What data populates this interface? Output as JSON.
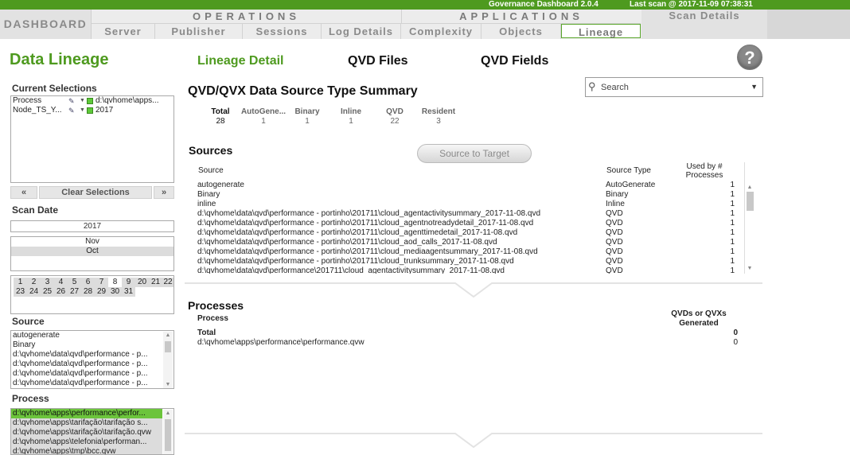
{
  "topbar": {
    "title": "Governance Dashboard 2.0.4",
    "scan": "Last scan @ 2017-11-09 07:38:31"
  },
  "nav": {
    "dashboard": "DASHBOARD",
    "operations": "OPERATIONS",
    "applications": "APPLICATIONS",
    "scan_details": "Scan Details",
    "tabs": [
      "Server",
      "Publisher",
      "Sessions",
      "Log Details",
      "Complexity",
      "Objects",
      "Lineage"
    ]
  },
  "header": {
    "title": "Data Lineage",
    "subnav": [
      "Lineage Detail",
      "QVD Files",
      "QVD Fields"
    ],
    "help": "?"
  },
  "left": {
    "current_selections_label": "Current Selections",
    "selections": [
      {
        "field": "Process",
        "value": "d:\\qvhome\\apps..."
      },
      {
        "field": "Node_TS_Y...",
        "value": "2017"
      }
    ],
    "prev": "«",
    "clear": "Clear Selections",
    "next": "»",
    "scan_date_label": "Scan Date",
    "year": "2017",
    "months": [
      "Nov",
      "Oct"
    ],
    "days": [
      "1",
      "2",
      "3",
      "4",
      "5",
      "6",
      "7",
      "8",
      "9",
      "20",
      "21",
      "22",
      "23",
      "24",
      "25",
      "26",
      "27",
      "28",
      "29",
      "30",
      "31"
    ],
    "source_label": "Source",
    "sources": [
      "autogenerate",
      "Binary",
      "d:\\qvhome\\data\\qvd\\performance - p...",
      "d:\\qvhome\\data\\qvd\\performance - p...",
      "d:\\qvhome\\data\\qvd\\performance - p...",
      "d:\\qvhome\\data\\qvd\\performance - p..."
    ],
    "process_label": "Process",
    "processes": [
      "d:\\qvhome\\apps\\performance\\perfor...",
      "d:\\qvhome\\apps\\tarifação\\tarifação s...",
      "d:\\qvhome\\apps\\tarifação\\tarifação.qvw",
      "d:\\qvhome\\apps\\telefonia\\performan...",
      "d:\\qvhome\\apps\\tmp\\bcc.qvw"
    ]
  },
  "main": {
    "title": "QVD/QVX Data Source Type Summary",
    "search_placeholder": "Search",
    "kpis": [
      {
        "label": "Total",
        "value": "28"
      },
      {
        "label": "AutoGene...",
        "value": "1"
      },
      {
        "label": "Binary",
        "value": "1"
      },
      {
        "label": "Inline",
        "value": "1"
      },
      {
        "label": "QVD",
        "value": "22"
      },
      {
        "label": "Resident",
        "value": "3"
      }
    ],
    "sources_title": "Sources",
    "source_to_target": "Source to Target",
    "sources_headers": {
      "source": "Source",
      "type": "Source Type",
      "used": "Used by # Processes"
    },
    "sources_rows": [
      {
        "source": "autogenerate",
        "type": "AutoGenerate",
        "used": "1"
      },
      {
        "source": "Binary",
        "type": "Binary",
        "used": "1"
      },
      {
        "source": "inline",
        "type": "Inline",
        "used": "1"
      },
      {
        "source": "d:\\qvhome\\data\\qvd\\performance - portinho\\201711\\cloud_agentactivitysummary_2017-11-08.qvd",
        "type": "QVD",
        "used": "1"
      },
      {
        "source": "d:\\qvhome\\data\\qvd\\performance - portinho\\201711\\cloud_agentnotreadydetail_2017-11-08.qvd",
        "type": "QVD",
        "used": "1"
      },
      {
        "source": "d:\\qvhome\\data\\qvd\\performance - portinho\\201711\\cloud_agenttimedetail_2017-11-08.qvd",
        "type": "QVD",
        "used": "1"
      },
      {
        "source": "d:\\qvhome\\data\\qvd\\performance - portinho\\201711\\cloud_aod_calls_2017-11-08.qvd",
        "type": "QVD",
        "used": "1"
      },
      {
        "source": "d:\\qvhome\\data\\qvd\\performance - portinho\\201711\\cloud_mediaagentsummary_2017-11-08.qvd",
        "type": "QVD",
        "used": "1"
      },
      {
        "source": "d:\\qvhome\\data\\qvd\\performance - portinho\\201711\\cloud_trunksummary_2017-11-08.qvd",
        "type": "QVD",
        "used": "1"
      },
      {
        "source": "d:\\qvhome\\data\\qvd\\performance\\201711\\cloud_agentactivitysummary_2017-11-08.qvd",
        "type": "QVD",
        "used": "1"
      }
    ],
    "processes_title": "Processes",
    "processes_headers": {
      "process": "Process",
      "generated": "QVDs or QVXs Generated"
    },
    "processes_total_label": "Total",
    "processes_total_value": "0",
    "processes_rows": [
      {
        "process": "d:\\qvhome\\apps\\performance\\performance.qvw",
        "value": "0"
      }
    ]
  }
}
